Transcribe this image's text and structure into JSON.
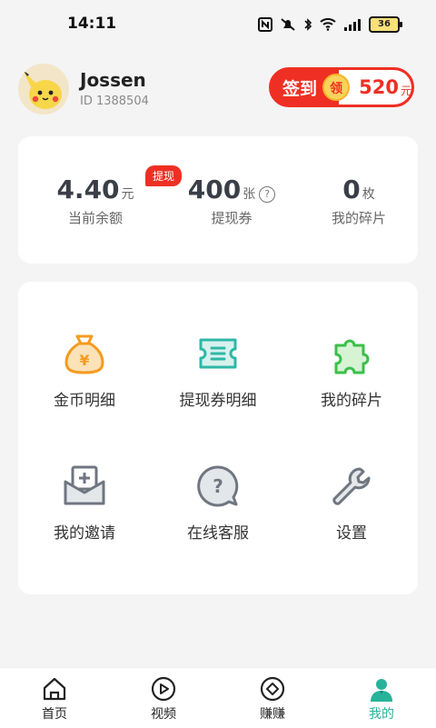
{
  "status_bar": {
    "time": "14:11",
    "battery": "36",
    "icons": [
      "nfc-icon",
      "mute-icon",
      "bluetooth-icon",
      "wifi-icon",
      "signal-icon",
      "battery-icon"
    ]
  },
  "profile": {
    "username": "Jossen",
    "user_id": "ID  1388504"
  },
  "checkin": {
    "label": "签到",
    "badge": "领",
    "reward_value": "520",
    "reward_unit": "元"
  },
  "balance": {
    "withdraw_badge": "提现",
    "stats": [
      {
        "value": "4.40",
        "unit": "元",
        "label": "当前余额"
      },
      {
        "value": "400",
        "unit": "张",
        "label": "提现券"
      },
      {
        "value": "0",
        "unit": "枚",
        "label": "我的碎片"
      }
    ]
  },
  "menu": {
    "items": [
      {
        "label": "金币明细",
        "icon": "money-bag-icon"
      },
      {
        "label": "提现券明细",
        "icon": "ticket-icon"
      },
      {
        "label": "我的碎片",
        "icon": "puzzle-icon"
      },
      {
        "label": "我的邀请",
        "icon": "invite-mail-icon"
      },
      {
        "label": "在线客服",
        "icon": "help-chat-icon"
      },
      {
        "label": "设置",
        "icon": "wrench-icon"
      }
    ]
  },
  "bottom_nav": {
    "items": [
      {
        "label": "首页",
        "icon": "home-icon"
      },
      {
        "label": "视频",
        "icon": "play-icon"
      },
      {
        "label": "赚赚",
        "icon": "diamond-icon"
      },
      {
        "label": "我的",
        "icon": "profile-icon"
      }
    ]
  },
  "colors": {
    "accent_red": "#ef2f23",
    "active_green": "#27b39a",
    "coin_orange": "#f49b1f",
    "ticket_teal": "#2fb7a7",
    "puzzle_green": "#3cbf4a",
    "gray_icon": "#6f7680"
  }
}
